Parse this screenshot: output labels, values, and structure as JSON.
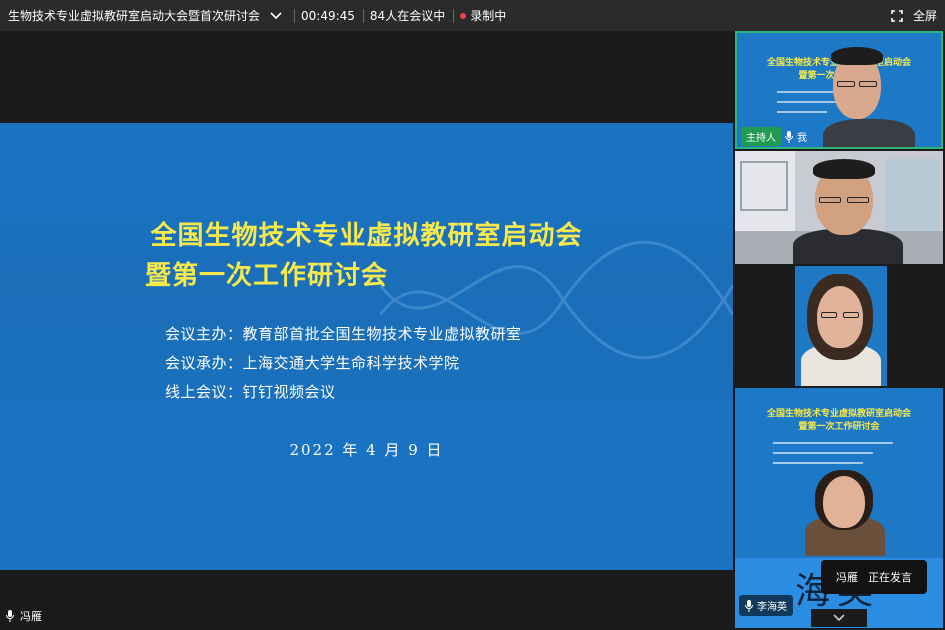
{
  "topbar": {
    "meeting_title": "生物技术专业虚拟教研室启动大会暨首次研讨会",
    "duration": "00:49:45",
    "attendees": "84人在会议中",
    "recording": "录制中",
    "fullscreen": "全屏"
  },
  "slide": {
    "title_line1": "全国生物技术专业虚拟教研室启动会",
    "title_line2": "暨第一次工作研讨会",
    "organizer": "会议主办：教育部首批全国生物技术专业虚拟教研室",
    "host_org": "会议承办：上海交通大学生命科学技术学院",
    "online": "线上会议：钉钉视频会议",
    "date": "2022 年 4 月 9 日"
  },
  "current_speaker_bottom": "冯雁",
  "panel": {
    "tile1": {
      "host_badge": "主持人",
      "me_label": "我",
      "mini_title1": "全国生物技术专业虚拟教研室启动会",
      "mini_title2": "暨第一次工作研讨会"
    },
    "tile4": {
      "mini_title1": "全国生物技术专业虚拟教研室启动会",
      "mini_title2": "暨第一次工作研讨会",
      "name_glyph": "海英",
      "name_tag": "李海英"
    },
    "speaking_name": "冯雁",
    "speaking_status": "正在发言"
  },
  "colors": {
    "slide_blue": "#1a73c2",
    "title_yellow": "#f7e94b",
    "host_green": "#1f9c52",
    "record_red": "#e5484d"
  }
}
